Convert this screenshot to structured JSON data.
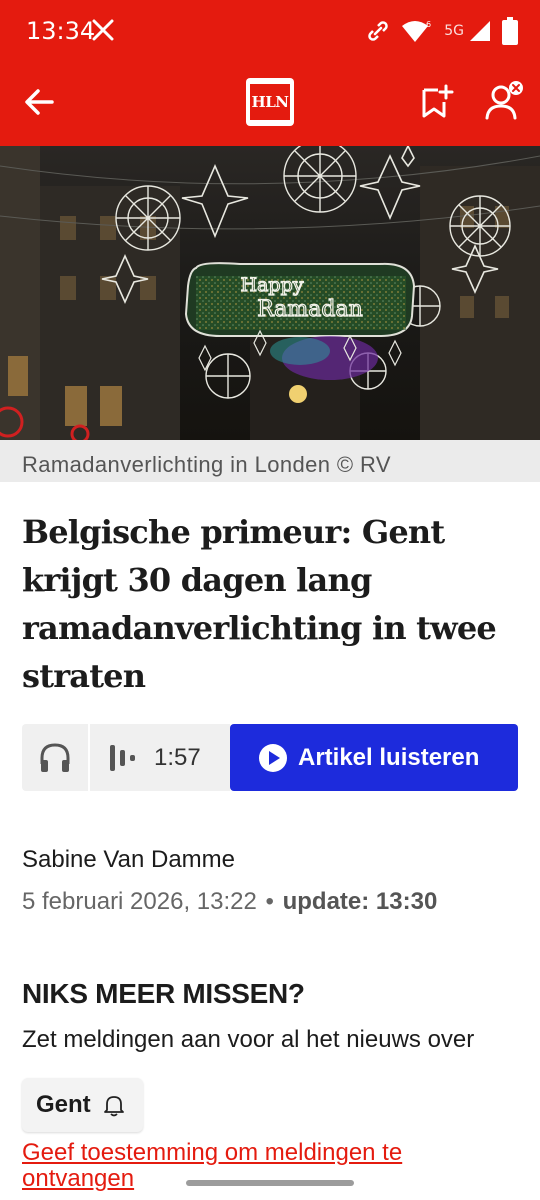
{
  "status_bar": {
    "time": "13:34",
    "network": "5G",
    "icons": [
      "x-logo-icon",
      "link-icon",
      "wifi-icon",
      "signal-icon",
      "battery-icon"
    ]
  },
  "app_bar": {
    "logo_text": "HLN",
    "icons": [
      "back-arrow-icon",
      "bookmark-add-icon",
      "profile-icon"
    ]
  },
  "hero": {
    "sign_line1": "Happy",
    "sign_line2": "Ramadan"
  },
  "caption": "Ramadanverlichting in Londen © RV",
  "article": {
    "headline": "Belgische primeur: Gent krijgt 30 dagen lang ramadanverlichting in twee straten",
    "author": "Sabine Van Damme",
    "date": "5 februari 2026, 13:22",
    "separator": "•",
    "update": "update: 13:30"
  },
  "audio": {
    "duration": "1:57",
    "listen_label": "Artikel luisteren"
  },
  "notify": {
    "heading": "NIKS MEER MISSEN?",
    "text": "Zet meldingen aan voor al het nieuws over",
    "topic": "Gent",
    "consent_link": "Geef toestemming om meldingen te ontvangen"
  },
  "colors": {
    "brand_red": "#e41b0f",
    "listen_blue": "#1d2bdc"
  }
}
